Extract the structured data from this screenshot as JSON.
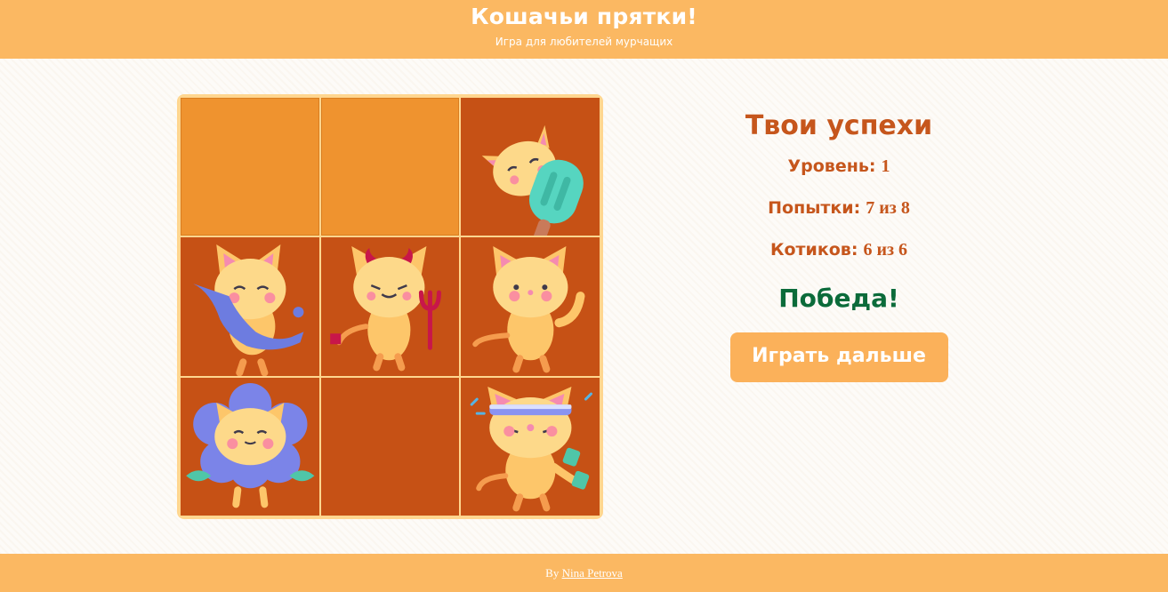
{
  "header": {
    "title": "Кошачьи прятки!",
    "subtitle": "Игра для любителей мурчащих"
  },
  "board": {
    "cells": [
      {
        "state": "closed",
        "cat": null
      },
      {
        "state": "closed",
        "cat": null
      },
      {
        "state": "open",
        "cat": "cat-with-popsicle"
      },
      {
        "state": "open",
        "cat": "cat-with-fish"
      },
      {
        "state": "open",
        "cat": "devil-cat-with-trident"
      },
      {
        "state": "open",
        "cat": "cat-waving"
      },
      {
        "state": "open",
        "cat": "cat-in-flower-costume"
      },
      {
        "state": "open",
        "cat": null
      },
      {
        "state": "open",
        "cat": "cat-with-dumbbell"
      }
    ]
  },
  "panel": {
    "heading": "Твои успехи",
    "level_label": "Уровень:",
    "level_value": "1",
    "attempts_label": "Попытки:",
    "attempts_value": "7 из 8",
    "cats_label": "Котиков:",
    "cats_value": "6 из 6",
    "result": "Победа!",
    "continue_button": "Играть дальше"
  },
  "footer": {
    "prefix": "By",
    "author": "Nina Petrova"
  },
  "colors": {
    "header_bg": "#fbb862",
    "closed_cell": "#ef932f",
    "open_cell": "#c65115",
    "heading_text": "#c6561c",
    "win_text": "#0b6b3a",
    "button_bg": "#fbb15a"
  }
}
